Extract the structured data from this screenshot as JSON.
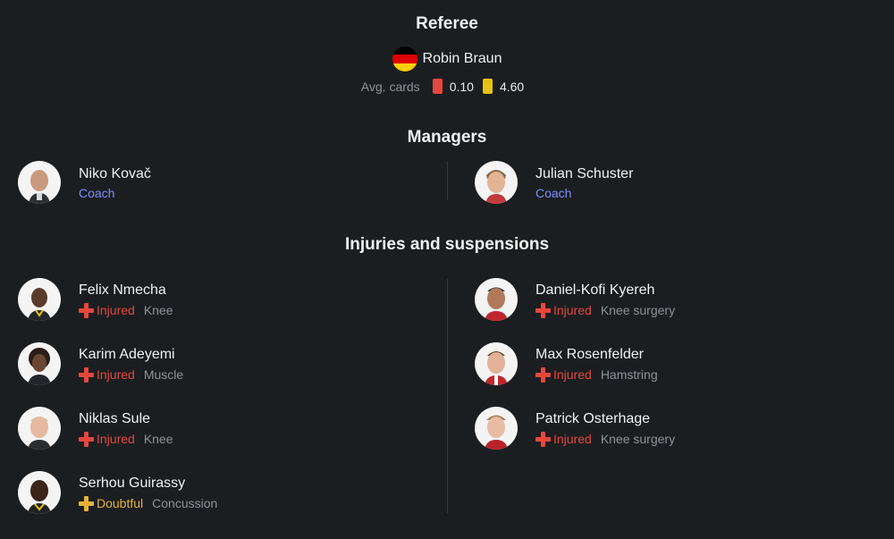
{
  "referee": {
    "title": "Referee",
    "name": "Robin Braun",
    "flag_colors": [
      "#000000",
      "#dd0000",
      "#ffce00"
    ],
    "avg_cards_label": "Avg. cards",
    "red_cards": "0.10",
    "yellow_cards": "4.60",
    "red_color": "#e5473d",
    "yellow_color": "#e8c20f"
  },
  "managers": {
    "title": "Managers",
    "left": {
      "name": "Niko Kovač",
      "role": "Coach"
    },
    "right": {
      "name": "Julian Schuster",
      "role": "Coach"
    }
  },
  "injuries": {
    "title": "Injuries and suspensions",
    "left": [
      {
        "name": "Felix Nmecha",
        "status": "Injured",
        "reason": "Knee"
      },
      {
        "name": "Karim Adeyemi",
        "status": "Injured",
        "reason": "Muscle"
      },
      {
        "name": "Niklas Sule",
        "status": "Injured",
        "reason": "Knee"
      },
      {
        "name": "Serhou Guirassy",
        "status": "Doubtful",
        "reason": "Concussion"
      }
    ],
    "right": [
      {
        "name": "Daniel-Kofi Kyereh",
        "status": "Injured",
        "reason": "Knee surgery"
      },
      {
        "name": "Max Rosenfelder",
        "status": "Injured",
        "reason": "Hamstring"
      },
      {
        "name": "Patrick Osterhage",
        "status": "Injured",
        "reason": "Knee surgery"
      }
    ]
  },
  "colors": {
    "injured": "#e5473d",
    "doubtful": "#e8b33a",
    "coach": "#7f8cff"
  }
}
